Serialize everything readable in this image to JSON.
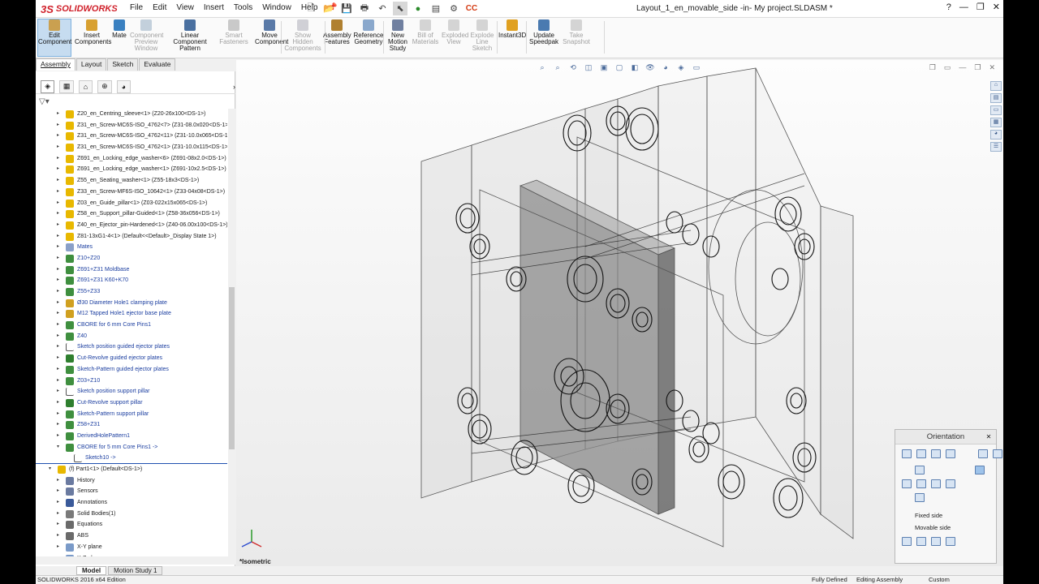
{
  "app": {
    "logo_ds": "3S",
    "logo_text": "SOLIDWORKS",
    "title": "Layout_1_en_movable_side -in- My project.SLDASM *"
  },
  "menu": [
    "File",
    "Edit",
    "View",
    "Insert",
    "Tools",
    "Window",
    "Help"
  ],
  "quick_access": [
    "new-icon",
    "open-icon",
    "save-icon",
    "print-icon",
    "undo-icon",
    "select-icon",
    "rebuild-icon",
    "options-icon",
    "cc-icon"
  ],
  "window_controls": {
    "help": "?",
    "minimize": "—",
    "restore": "❐",
    "close": "✕"
  },
  "commands": [
    {
      "label": "Edit Component",
      "state": "active"
    },
    {
      "label": "Insert Components",
      "state": "normal"
    },
    {
      "label": "Mate",
      "state": "normal"
    },
    {
      "label": "Component Preview Window",
      "state": "disabled"
    },
    {
      "label": "Linear Component Pattern",
      "state": "normal"
    },
    {
      "label": "Smart Fasteners",
      "state": "disabled"
    },
    {
      "label": "Move Component",
      "state": "normal"
    },
    {
      "label": "Show Hidden Components",
      "state": "disabled"
    },
    {
      "label": "Assembly Features",
      "state": "normal"
    },
    {
      "label": "Reference Geometry",
      "state": "normal"
    },
    {
      "label": "New Motion Study",
      "state": "normal"
    },
    {
      "label": "Bill of Materials",
      "state": "disabled"
    },
    {
      "label": "Exploded View",
      "state": "disabled"
    },
    {
      "label": "Explode Line Sketch",
      "state": "disabled"
    },
    {
      "label": "Instant3D",
      "state": "normal"
    },
    {
      "label": "Update Speedpak",
      "state": "normal"
    },
    {
      "label": "Take Snapshot",
      "state": "disabled"
    }
  ],
  "tabs": [
    "Assembly",
    "Layout",
    "Sketch",
    "Evaluate"
  ],
  "active_tab": "Assembly",
  "tree": [
    {
      "label": "Z20_en_Centring_sleeve<1> (Z20-26x100<DS-1>)",
      "indent": 1,
      "icon": "part",
      "blue": false
    },
    {
      "label": "Z31_en_Screw-MC6S-ISO_4762<7> (Z31-08.0x020<DS-1>)",
      "indent": 1,
      "icon": "part",
      "blue": false
    },
    {
      "label": "Z31_en_Screw-MC6S-ISO_4762<11> (Z31-10.0x065<DS-1>)",
      "indent": 1,
      "icon": "part",
      "blue": false
    },
    {
      "label": "Z31_en_Screw-MC6S-ISO_4762<1> (Z31-10.0x115<DS-1>)",
      "indent": 1,
      "icon": "part",
      "blue": false
    },
    {
      "label": "Z691_en_Locking_edge_washer<6> (Z691-08x2.0<DS-1>)",
      "indent": 1,
      "icon": "part",
      "blue": false
    },
    {
      "label": "Z691_en_Locking_edge_washer<1> (Z691-10x2.5<DS-1>)",
      "indent": 1,
      "icon": "part",
      "blue": false
    },
    {
      "label": "Z55_en_Seating_washer<1> (Z55-18x3<DS-1>)",
      "indent": 1,
      "icon": "part",
      "blue": false
    },
    {
      "label": "Z33_en_Screw-MF6S-ISO_10642<1> (Z33-04x08<DS-1>)",
      "indent": 1,
      "icon": "part",
      "blue": false
    },
    {
      "label": "Z03_en_Guide_pillar<1> (Z03-022x15x065<DS-1>)",
      "indent": 1,
      "icon": "part",
      "blue": false
    },
    {
      "label": "Z58_en_Support_pillar-Guided<1> (Z58-36x056<DS-1>)",
      "indent": 1,
      "icon": "part",
      "blue": false
    },
    {
      "label": "Z40_en_Ejector_pin-Hardened<1> (Z40-06.00x100<DS-1>)",
      "indent": 1,
      "icon": "part",
      "blue": false
    },
    {
      "label": "Z81-13xG1-4<1> (Default<<Default>_Display State 1>)",
      "indent": 1,
      "icon": "part",
      "blue": false
    },
    {
      "label": "Mates",
      "indent": 1,
      "icon": "mates",
      "blue": true
    },
    {
      "label": "Z10+Z20",
      "indent": 1,
      "icon": "pattern",
      "blue": true
    },
    {
      "label": "Z691+Z31 Moldbase",
      "indent": 1,
      "icon": "pattern",
      "blue": true
    },
    {
      "label": "Z691+Z31 K60+K70",
      "indent": 1,
      "icon": "pattern",
      "blue": true
    },
    {
      "label": "Z55+Z33",
      "indent": 1,
      "icon": "pattern",
      "blue": true
    },
    {
      "label": "Ø30 Diameter Hole1 clamping plate",
      "indent": 1,
      "icon": "hole",
      "blue": true
    },
    {
      "label": "M12 Tapped Hole1 ejector base plate",
      "indent": 1,
      "icon": "hole",
      "blue": true
    },
    {
      "label": "CBORE for 6 mm Core Pins1",
      "indent": 1,
      "icon": "pattern",
      "blue": true
    },
    {
      "label": "Z40",
      "indent": 1,
      "icon": "pattern",
      "blue": true
    },
    {
      "label": "Sketch position guided ejector plates",
      "indent": 1,
      "icon": "sketch",
      "blue": true
    },
    {
      "label": "Cut-Revolve guided ejector plates",
      "indent": 1,
      "icon": "cut",
      "blue": true
    },
    {
      "label": "Sketch-Pattern guided ejector plates",
      "indent": 1,
      "icon": "skpattern",
      "blue": true
    },
    {
      "label": "Z03+Z10",
      "indent": 1,
      "icon": "pattern",
      "blue": true
    },
    {
      "label": "Sketch position support pillar",
      "indent": 1,
      "icon": "sketch",
      "blue": true
    },
    {
      "label": "Cut-Revolve support pillar",
      "indent": 1,
      "icon": "cut",
      "blue": true
    },
    {
      "label": "Sketch-Pattern support pillar",
      "indent": 1,
      "icon": "skpattern",
      "blue": true
    },
    {
      "label": "Z58+Z31",
      "indent": 1,
      "icon": "pattern",
      "blue": true
    },
    {
      "label": "DerivedHolePattern1",
      "indent": 1,
      "icon": "pattern",
      "blue": true
    },
    {
      "label": "CBORE for 5 mm Core Pins1 ->",
      "indent": 1,
      "icon": "pattern",
      "blue": true,
      "expanded": true
    },
    {
      "label": "Sketch10 ->",
      "indent": 2,
      "icon": "sketch",
      "blue": true,
      "sep": true
    },
    {
      "label": "(f) Part1<1> (Default<DS-1>)",
      "indent": 0,
      "icon": "part",
      "blue": false,
      "expanded": true
    },
    {
      "label": "History",
      "indent": 1,
      "icon": "history",
      "blue": false
    },
    {
      "label": "Sensors",
      "indent": 1,
      "icon": "sensor",
      "blue": false
    },
    {
      "label": "Annotations",
      "indent": 1,
      "icon": "annotation",
      "blue": false
    },
    {
      "label": "Solid Bodies(1)",
      "indent": 1,
      "icon": "solid",
      "blue": false
    },
    {
      "label": "Equations",
      "indent": 1,
      "icon": "equation",
      "blue": false
    },
    {
      "label": "ABS",
      "indent": 1,
      "icon": "material",
      "blue": false
    },
    {
      "label": "X-Y plane",
      "indent": 1,
      "icon": "plane",
      "blue": false
    },
    {
      "label": "X-Z plane",
      "indent": 1,
      "icon": "plane",
      "blue": false
    }
  ],
  "viewport": {
    "view_name": "*Isometric"
  },
  "orientation": {
    "title": "Orientation",
    "views": [
      "Fixed side",
      "Movable side"
    ]
  },
  "bottom_tabs": [
    "Model",
    "Motion Study 1"
  ],
  "active_bottom_tab": "Model",
  "status": {
    "edition": "SOLIDWORKS 2016 x64 Edition",
    "defined": "Fully Defined",
    "mode": "Editing Assembly",
    "units": "Custom"
  },
  "colors": {
    "accent": "#2050b0",
    "part_icon": "#e8b800",
    "highlight": "#c6dcf0",
    "logo": "#d0202a"
  }
}
